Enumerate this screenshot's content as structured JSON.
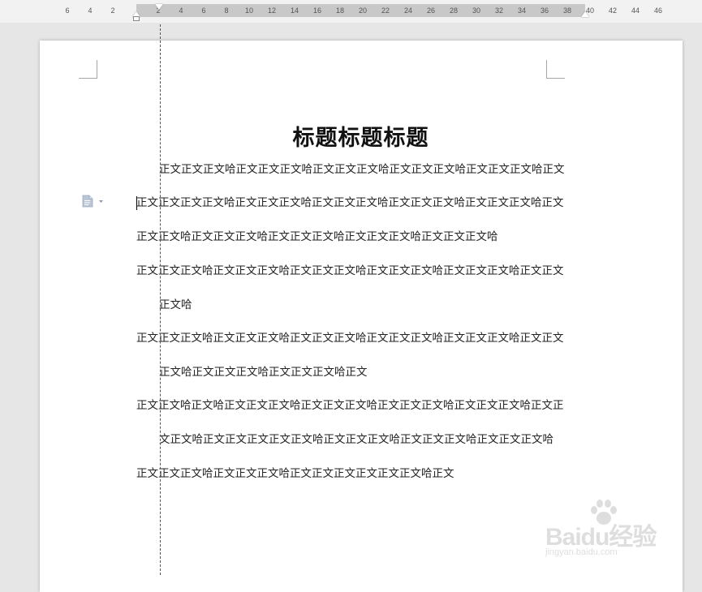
{
  "ruler": {
    "ticks": [
      "6",
      "4",
      "2",
      "2",
      "4",
      "6",
      "8",
      "10",
      "12",
      "14",
      "16",
      "18",
      "20",
      "22",
      "24",
      "26",
      "28",
      "30",
      "32",
      "34",
      "36",
      "38",
      "40",
      "42",
      "44",
      "46"
    ]
  },
  "document": {
    "title": "标题标题标题",
    "lines": [
      "正文正文正文哈正文正文正文哈正文正文正文哈正文正文正文哈正文正文正文哈正文",
      "正文正文正文正文哈正文正文正文哈正文正文正文哈正文正文正文哈正文正文正文哈正文",
      "正文正文哈正文正文正文哈正文正文正文哈正文正文正文哈正文正文正文哈",
      "正文正文正文哈正文正文正文哈正文正文正文哈正文正文正文哈正文正文正文哈正文正文",
      "正文哈",
      "正文正文正文哈正文正文正文哈正文正文正文哈正文正文正文哈正文正文正文哈正文正文",
      "正文哈正文正文正文哈正文正文正文哈正文",
      "正文正文哈正文哈正文正文正文哈正文正文正文哈正文正文正文哈正文正文正文哈正文正",
      "文正文哈正文正文正文正文正文哈正文正文正文哈正文正文正文哈正文正文正文哈",
      "正文正文正文哈正文正文正文哈正文正文正文正文正文正文哈正文"
    ]
  },
  "watermark": {
    "brand": "Baidu经验",
    "url": "jingyan.baidu.com"
  },
  "colors": {
    "background": "#e6e6e6",
    "page": "#ffffff",
    "ruler_active": "#c8c8c8"
  },
  "icons": {
    "margin_icon": "document-options-icon",
    "watermark_icon": "paw-icon"
  }
}
